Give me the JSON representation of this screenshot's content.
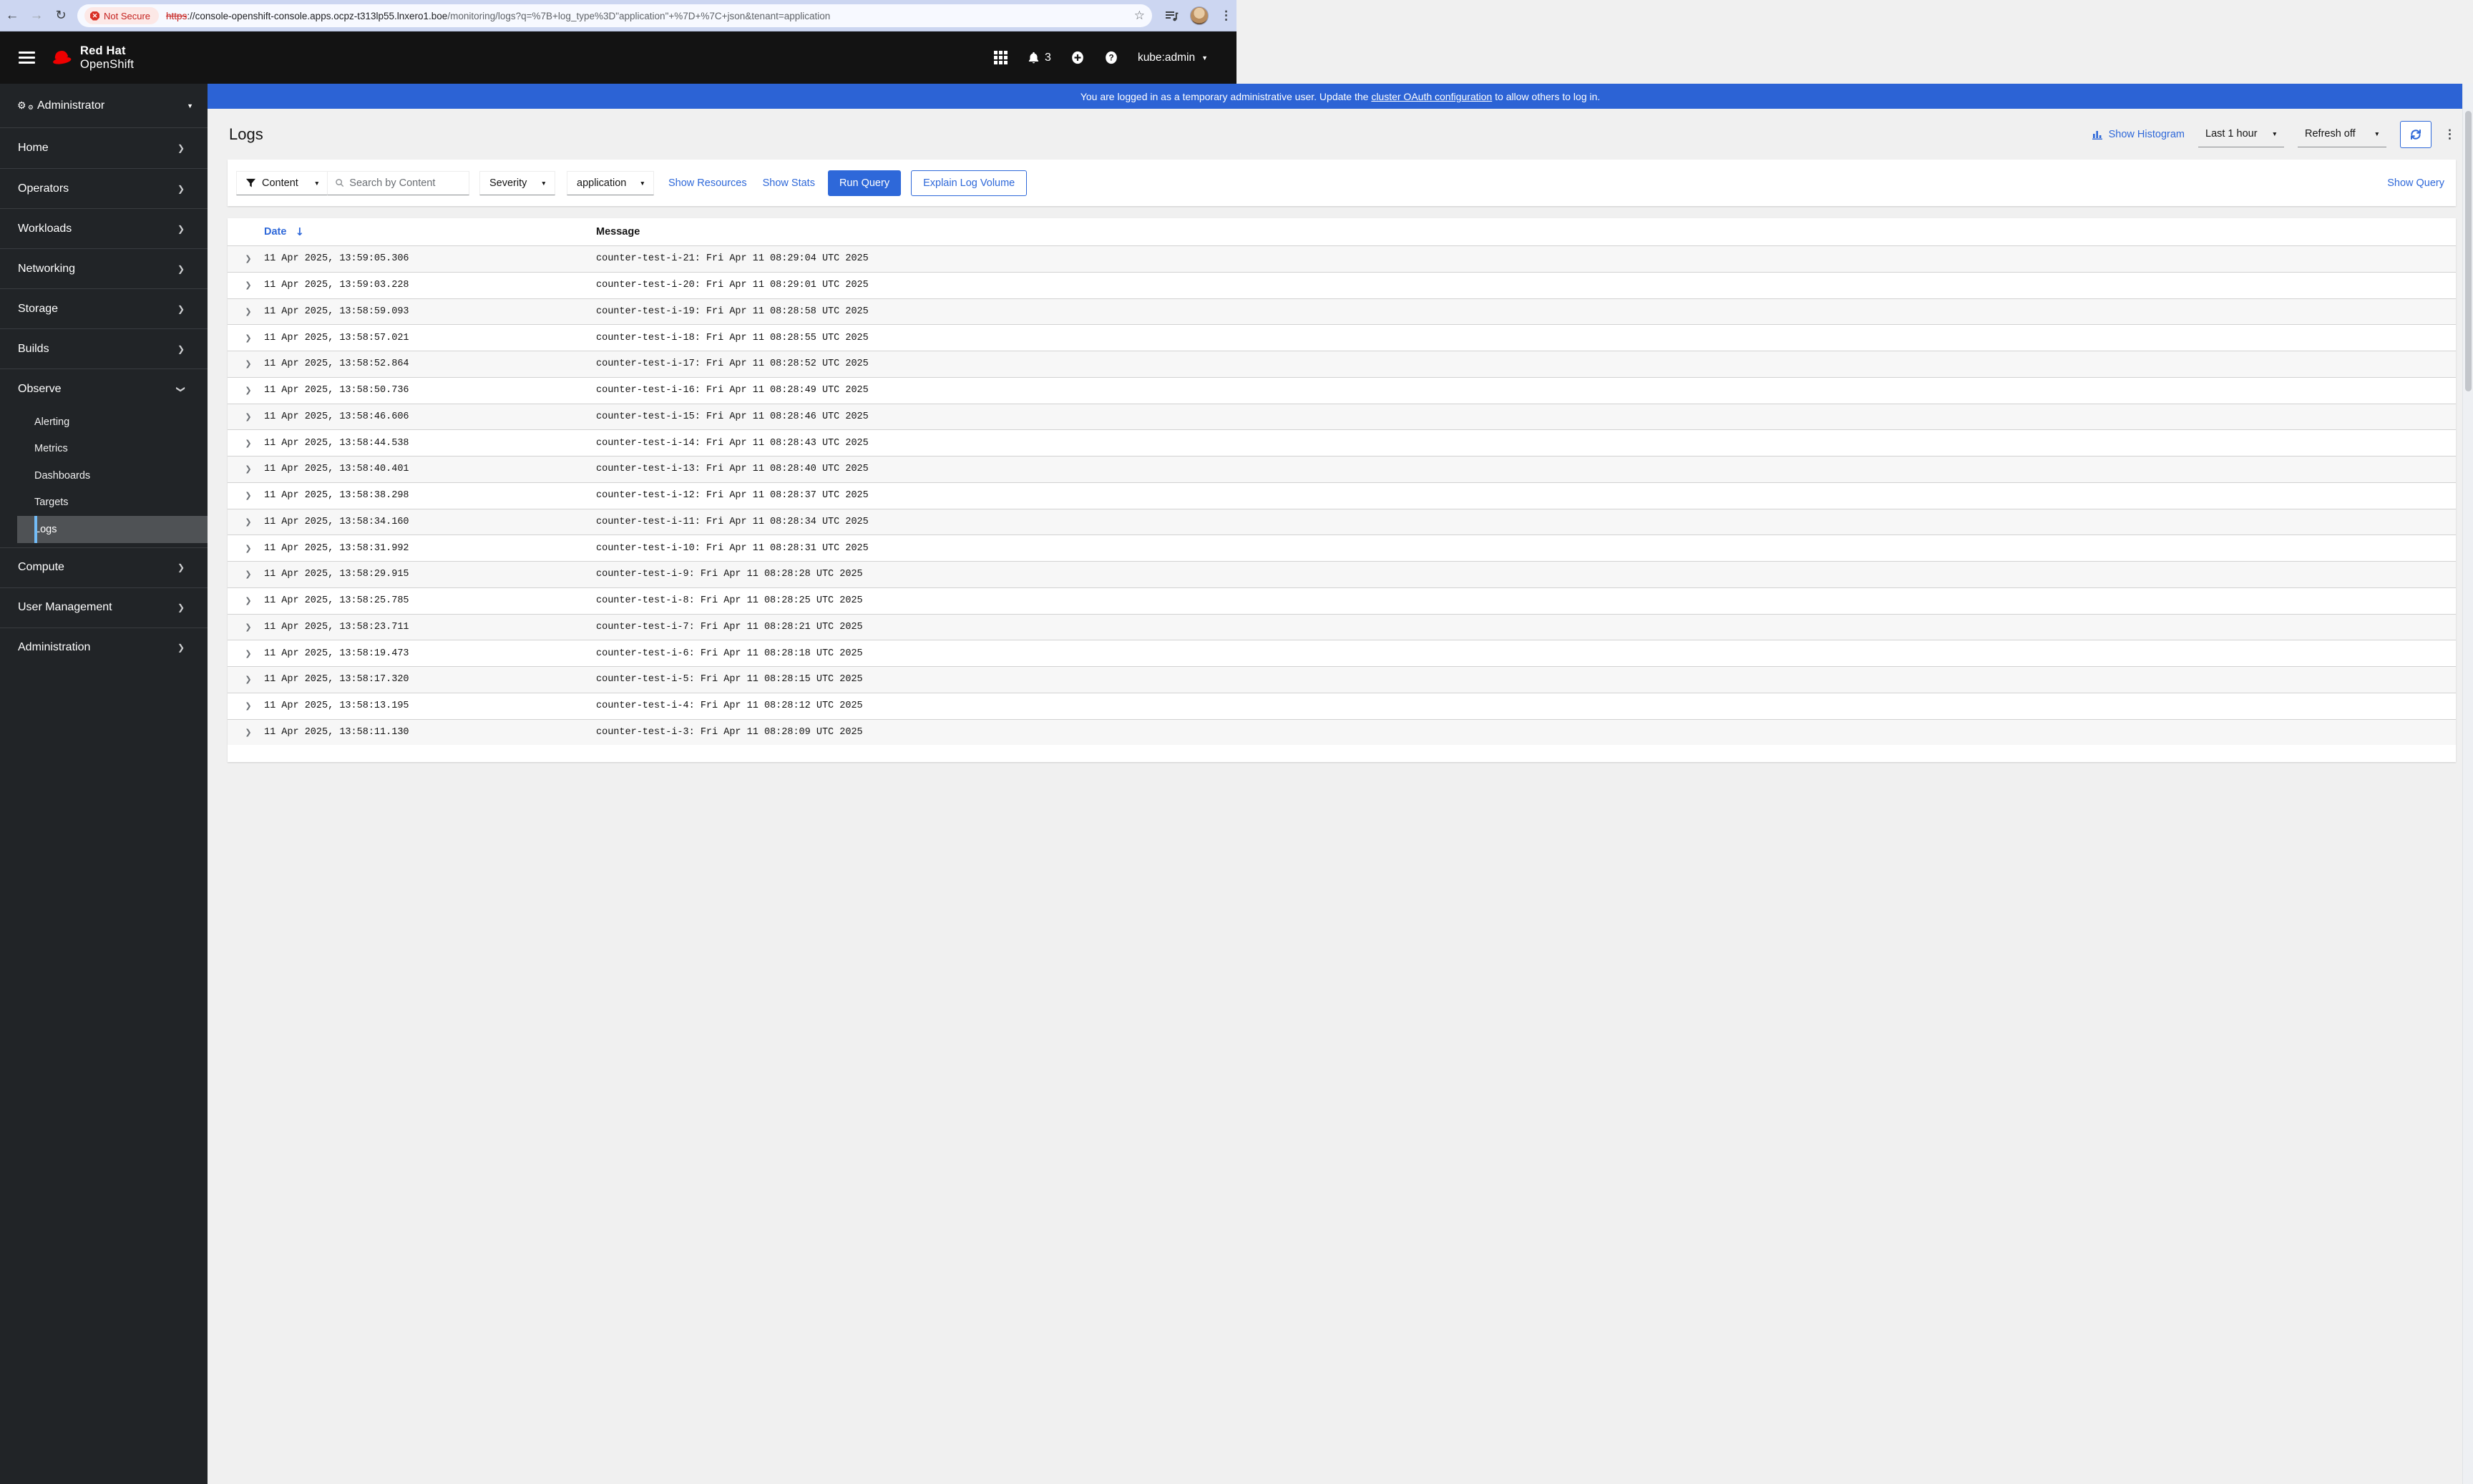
{
  "browser": {
    "not_secure_label": "Not Secure",
    "url_scheme": "https",
    "url_host": "://console-openshift-console.apps.ocpz-t313lp55.lnxero1.boe",
    "url_path": "/monitoring/logs?q=%7B+log_type%3D\"application\"+%7D+%7C+json&tenant=application"
  },
  "icons": {
    "back": "←",
    "forward": "→",
    "reload": "↻",
    "star": "☆",
    "kebab": "⋮",
    "gear": "⚙",
    "chevron_right": "❯",
    "caret_down": "▼",
    "sort_down": "↓",
    "expander": "❯"
  },
  "masthead": {
    "brand_line1": "Red Hat",
    "brand_line2": "OpenShift",
    "notification_count": "3",
    "username": "kube:admin"
  },
  "banner": {
    "text_before": "You are logged in as a temporary administrative user. Update the ",
    "link_text": "cluster OAuth configuration",
    "text_after": " to allow others to log in."
  },
  "sidebar": {
    "perspective": "Administrator",
    "items": [
      {
        "label": "Home",
        "type": "top"
      },
      {
        "label": "Operators",
        "type": "top"
      },
      {
        "label": "Workloads",
        "type": "top"
      },
      {
        "label": "Networking",
        "type": "top"
      },
      {
        "label": "Storage",
        "type": "top"
      },
      {
        "label": "Builds",
        "type": "top"
      },
      {
        "label": "Observe",
        "type": "top",
        "expanded": true
      },
      {
        "label": "Alerting",
        "type": "sub"
      },
      {
        "label": "Metrics",
        "type": "sub"
      },
      {
        "label": "Dashboards",
        "type": "sub"
      },
      {
        "label": "Targets",
        "type": "sub"
      },
      {
        "label": "Logs",
        "type": "sub",
        "selected": true
      },
      {
        "label": "Compute",
        "type": "top"
      },
      {
        "label": "User Management",
        "type": "top"
      },
      {
        "label": "Administration",
        "type": "top"
      }
    ]
  },
  "page": {
    "title": "Logs",
    "show_histogram": "Show Histogram",
    "time_range": "Last 1 hour",
    "refresh": "Refresh off"
  },
  "toolbar": {
    "attribute_filter": "Content",
    "search_placeholder": "Search by Content",
    "severity": "Severity",
    "tenant": "application",
    "show_resources": "Show Resources",
    "show_stats": "Show Stats",
    "run_query": "Run Query",
    "explain_log_volume": "Explain Log Volume",
    "show_query": "Show Query"
  },
  "table": {
    "col_date": "Date",
    "col_message": "Message",
    "rows": [
      {
        "date": "11 Apr 2025, 13:59:05.306",
        "message": "counter-test-i-21: Fri Apr 11 08:29:04 UTC 2025"
      },
      {
        "date": "11 Apr 2025, 13:59:03.228",
        "message": "counter-test-i-20: Fri Apr 11 08:29:01 UTC 2025"
      },
      {
        "date": "11 Apr 2025, 13:58:59.093",
        "message": "counter-test-i-19: Fri Apr 11 08:28:58 UTC 2025"
      },
      {
        "date": "11 Apr 2025, 13:58:57.021",
        "message": "counter-test-i-18: Fri Apr 11 08:28:55 UTC 2025"
      },
      {
        "date": "11 Apr 2025, 13:58:52.864",
        "message": "counter-test-i-17: Fri Apr 11 08:28:52 UTC 2025"
      },
      {
        "date": "11 Apr 2025, 13:58:50.736",
        "message": "counter-test-i-16: Fri Apr 11 08:28:49 UTC 2025"
      },
      {
        "date": "11 Apr 2025, 13:58:46.606",
        "message": "counter-test-i-15: Fri Apr 11 08:28:46 UTC 2025"
      },
      {
        "date": "11 Apr 2025, 13:58:44.538",
        "message": "counter-test-i-14: Fri Apr 11 08:28:43 UTC 2025"
      },
      {
        "date": "11 Apr 2025, 13:58:40.401",
        "message": "counter-test-i-13: Fri Apr 11 08:28:40 UTC 2025"
      },
      {
        "date": "11 Apr 2025, 13:58:38.298",
        "message": "counter-test-i-12: Fri Apr 11 08:28:37 UTC 2025"
      },
      {
        "date": "11 Apr 2025, 13:58:34.160",
        "message": "counter-test-i-11: Fri Apr 11 08:28:34 UTC 2025"
      },
      {
        "date": "11 Apr 2025, 13:58:31.992",
        "message": "counter-test-i-10: Fri Apr 11 08:28:31 UTC 2025"
      },
      {
        "date": "11 Apr 2025, 13:58:29.915",
        "message": "counter-test-i-9: Fri Apr 11 08:28:28 UTC 2025"
      },
      {
        "date": "11 Apr 2025, 13:58:25.785",
        "message": "counter-test-i-8: Fri Apr 11 08:28:25 UTC 2025"
      },
      {
        "date": "11 Apr 2025, 13:58:23.711",
        "message": "counter-test-i-7: Fri Apr 11 08:28:21 UTC 2025"
      },
      {
        "date": "11 Apr 2025, 13:58:19.473",
        "message": "counter-test-i-6: Fri Apr 11 08:28:18 UTC 2025"
      },
      {
        "date": "11 Apr 2025, 13:58:17.320",
        "message": "counter-test-i-5: Fri Apr 11 08:28:15 UTC 2025"
      },
      {
        "date": "11 Apr 2025, 13:58:13.195",
        "message": "counter-test-i-4: Fri Apr 11 08:28:12 UTC 2025"
      },
      {
        "date": "11 Apr 2025, 13:58:11.130",
        "message": "counter-test-i-3: Fri Apr 11 08:28:09 UTC 2025"
      }
    ]
  },
  "colors": {
    "accent": "#2e68d9",
    "banner": "#2c63d5",
    "masthead": "#131313",
    "sidebar": "#212427",
    "sidebar_selected": "#4f5255",
    "selected_bar": "#73bcf7",
    "page_bg": "#f0f0f0",
    "stripe": "#f7f7f7",
    "row_border": "#d2d2d2",
    "not_secure_red": "#c5221f"
  }
}
